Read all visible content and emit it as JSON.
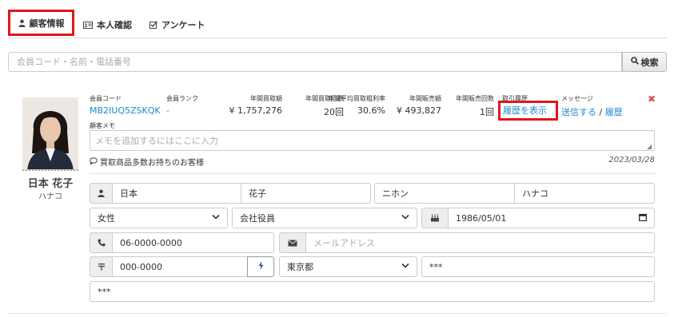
{
  "tabs": [
    {
      "label": "顧客情報",
      "icon": "user-icon",
      "active": true
    },
    {
      "label": "本人確認",
      "icon": "id-card-icon",
      "active": false
    },
    {
      "label": "アンケート",
      "icon": "checkbox-icon",
      "active": false
    }
  ],
  "search": {
    "placeholder": "会員コード・名前・電話番号",
    "button_label": "検索"
  },
  "customer": {
    "name": "日本 花子",
    "kana": "ハナコ",
    "member_code_label": "会員コード",
    "member_code": "MB2IUQ5ZSKQK",
    "rank_label": "会員ランク",
    "rank": "-",
    "annual_purchase_amount_label": "年間買取額",
    "annual_purchase_amount": "¥ 1,757,276",
    "annual_purchase_count_label": "年間買取回数",
    "annual_purchase_count": "20回",
    "annual_avg_margin_label": "年間平均買取粗利率",
    "annual_avg_margin": "30.6%",
    "annual_sales_amount_label": "年間販売額",
    "annual_sales_amount": "¥ 493,827",
    "annual_sales_count_label": "年間販売回数",
    "annual_sales_count": "1回",
    "history_label": "取引履歴",
    "history_link": "履歴を表示",
    "message_label": "メッセージ",
    "message_send": "送信する",
    "message_sep": "/",
    "message_history": "履歴",
    "memo_label": "顧客メモ",
    "memo_placeholder": "メモを追加するにはここに入力",
    "comment": "買取商品多数お持ちのお客様",
    "date": "2023/03/28"
  },
  "form": {
    "last_name": "日本",
    "first_name": "花子",
    "last_kana": "ニホン",
    "first_kana": "ハナコ",
    "gender": "女性",
    "occupation": "会社役員",
    "birthday": "1986/05/01",
    "phone": "06-0000-0000",
    "email_placeholder": "メールアドレス",
    "postal_code": "000-0000",
    "prefecture": "東京都",
    "city": "***",
    "address": "***"
  },
  "colors": {
    "highlight": "#e0161c",
    "link": "#1a8ad0",
    "close": "#d9534f"
  }
}
